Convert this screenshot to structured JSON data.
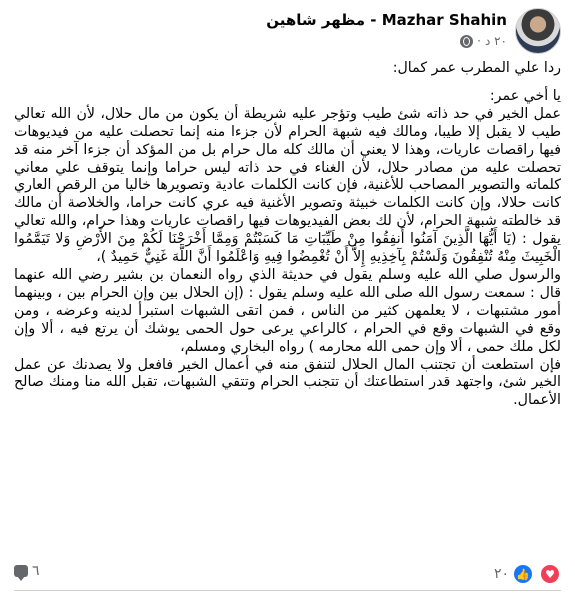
{
  "post": {
    "author": "Mazhar Shahin - مظهر شاهين",
    "timestamp": "٢٠ د",
    "privacy_icon": "globe-icon",
    "body": [
      "ردا علي المطرب عمر كمال:",
      "",
      "يا أخي عمر:",
      "عمل الخير في حد ذاته شئ طيب وتؤجر عليه شريطة أن يكون من مال حلال، لأن الله تعالي طيب لا يقبل إلا طيبا، ومالك فيه شبهة الحرام لأن جزءا منه إنما تحصلت عليه من فيديوهات فيها راقصات عاريات، وهذا لا يعني أن مالك كله مال حرام بل من المؤكد أن جزءا آخر منه قد تحصلت عليه من مصادر حلال، لأن الغناء في حد ذاته ليس حراما وإنما يتوقف علي معاني كلماته والتصوير المصاحب للأغنية، فإن كانت الكلمات عادية وتصويرها خاليا من الرقص العاري كانت حلالا، وإن كانت الكلمات خبيثة وتصوير الأغنية فيه عري كانت حراما، والخلاصة أن مالك قد خالطته شبهة الحرام، لأن لك بعض الفيديوهات فيها راقصات عاريات وهذا حرام، والله تعالي يقول : (يَا أَيُّهَا الَّذِينَ آمَنُوا أَنفِقُوا مِنْ طَيِّبَاتِ مَا كَسَبْتُمْ وَمِمَّا أَخْرَجْنَا لَكُمْ مِنَ الأَرْضِ وَلا تَيَمَّمُوا الْخَبِيثَ مِنْهُ تُنْفِقُونَ وَلَسْتُمْ بِآخِذِيهِ إِلاَّ أَنْ تُغْمِضُوا فِيهِ وَاعْلَمُوا أَنَّ اللَّهَ غَنِيٌّ حَمِيدٌ )،",
      "والرسول صلي الله عليه وسلم يقول في حديثة الذي رواه النعمان بن بشير رضي الله عنهما قال : سمعت رسول الله صلى الله عليه وسلم يقول : (إن الحلال بين وإن الحرام بين ، وبينهما أمور مشتبهات ، لا يعلمهن كثير من الناس ، فمن اتقى الشبهات استبرأ لدينه وعرضه ، ومن وقع في الشبهات وقع في الحرام ، كالراعي يرعى حول الحمى يوشك أن يرتع فيه ، ألا وإن لكل ملك حمى ، ألا وإن حمى الله محارمه ) رواه البخاري ومسلم،",
      "فإن استطعت أن تجتنب المال الحلال لتنفق منه في أعمال الخير فافعل ولا يصدنك عن عمل الخير شئ، واجتهد قدر استطاعتك أن تتجنب الحرام وتتقي الشبهات، تقبل الله منا ومنك صالح الأعمال."
    ],
    "reactions": {
      "count": "٢٠",
      "icons": [
        "love-icon",
        "like-icon"
      ]
    },
    "comments_count": "٦"
  }
}
